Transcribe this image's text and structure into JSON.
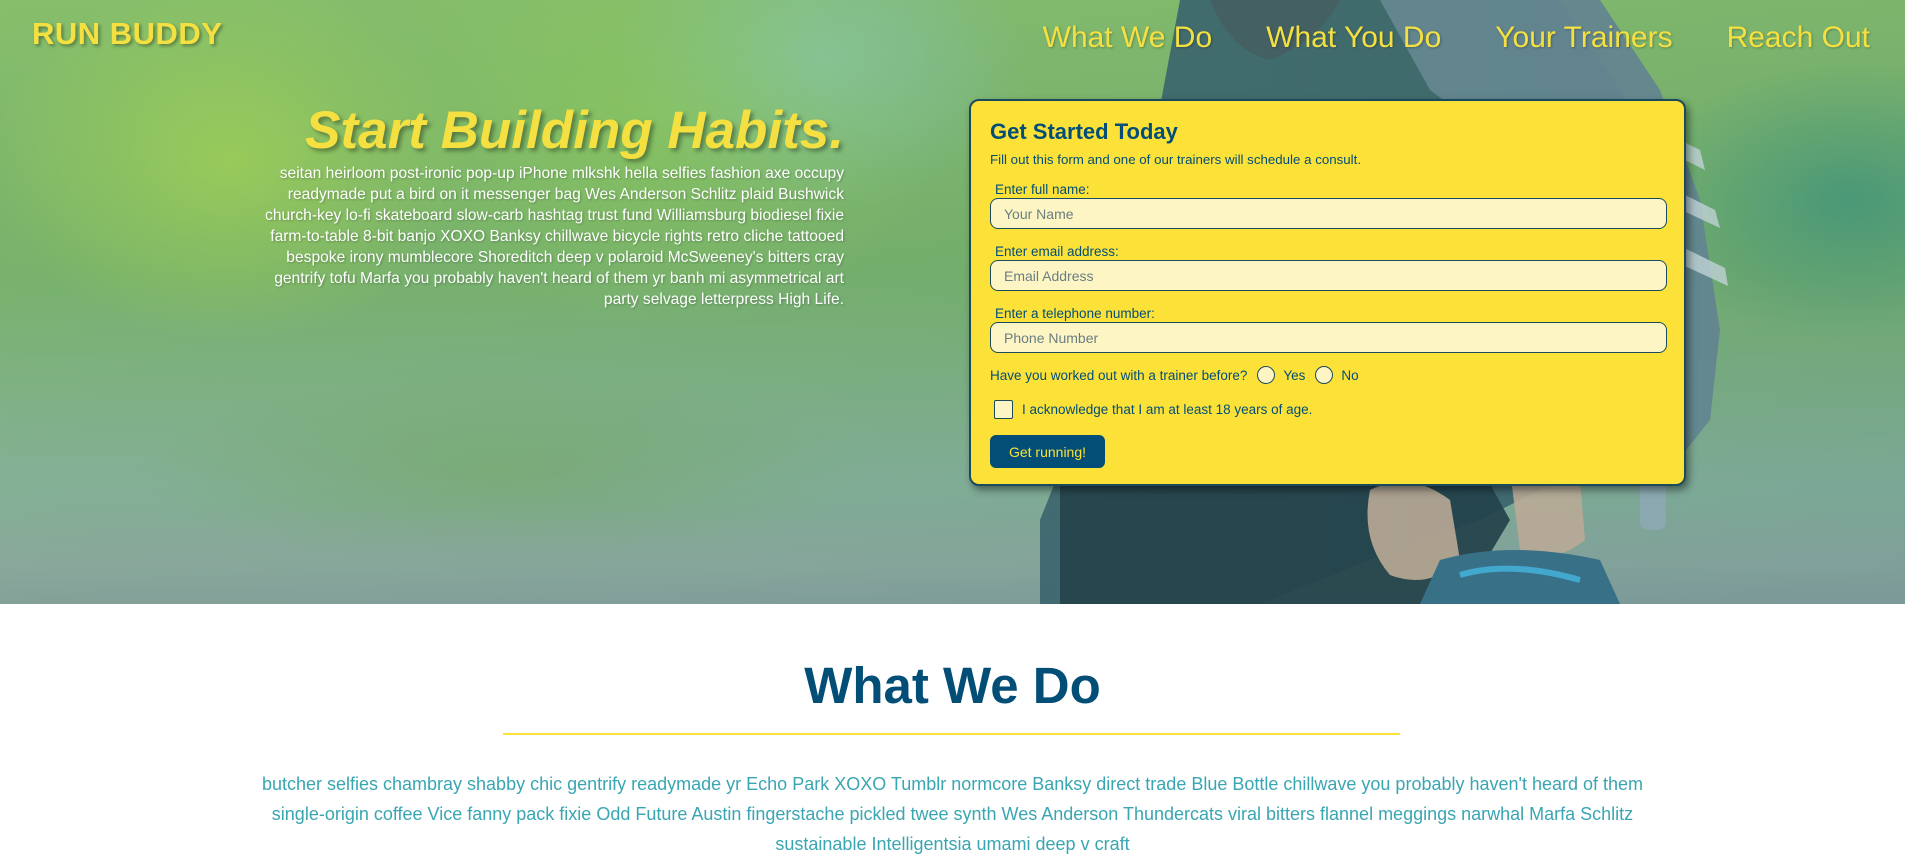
{
  "brand": {
    "name": "RUN BUDDY"
  },
  "nav": {
    "items": [
      "What We Do",
      "What You Do",
      "Your Trainers",
      "Reach Out"
    ]
  },
  "hero": {
    "title": "Start Building Habits.",
    "copy": "seitan heirloom post-ironic pop-up iPhone mlkshk hella selfies fashion axe occupy readymade put a bird on it messenger bag Wes Anderson Schlitz plaid Bushwick church-key lo-fi skateboard slow-carb hashtag trust fund Williamsburg biodiesel fixie farm-to-table 8-bit banjo XOXO Banksy chillwave bicycle rights retro cliche tattooed bespoke irony mumblecore Shoreditch deep v polaroid McSweeney's bitters cray gentrify tofu Marfa you probably haven't heard of them yr banh mi asymmetrical art party selvage letterpress High Life."
  },
  "form": {
    "title": "Get Started Today",
    "subtitle": "Fill out this form and one of our trainers will schedule a consult.",
    "name": {
      "label": "Enter full name:",
      "placeholder": "Your Name",
      "value": ""
    },
    "email": {
      "label": "Enter email address:",
      "placeholder": "Email Address",
      "value": ""
    },
    "phone": {
      "label": "Enter a telephone number:",
      "placeholder": "Phone Number",
      "value": ""
    },
    "trainer_question": "Have you worked out with a trainer before?",
    "radio_yes": "Yes",
    "radio_no": "No",
    "age_ack": "I acknowledge that I am at least 18 years of age.",
    "submit_label": "Get running!"
  },
  "what_we_do": {
    "title": "What We Do",
    "copy": "butcher selfies chambray shabby chic gentrify readymade yr Echo Park XOXO Tumblr normcore Banksy direct trade Blue Bottle chillwave you probably haven't heard of them single-origin coffee Vice fanny pack fixie Odd Future Austin fingerstache pickled twee synth Wes Anderson Thundercats viral bitters flannel meggings narwhal Marfa Schlitz sustainable Intelligentsia umami deep v craft"
  },
  "colors": {
    "yellow": "#fce138",
    "navy": "#024e76",
    "teal": "#39a6b2"
  }
}
